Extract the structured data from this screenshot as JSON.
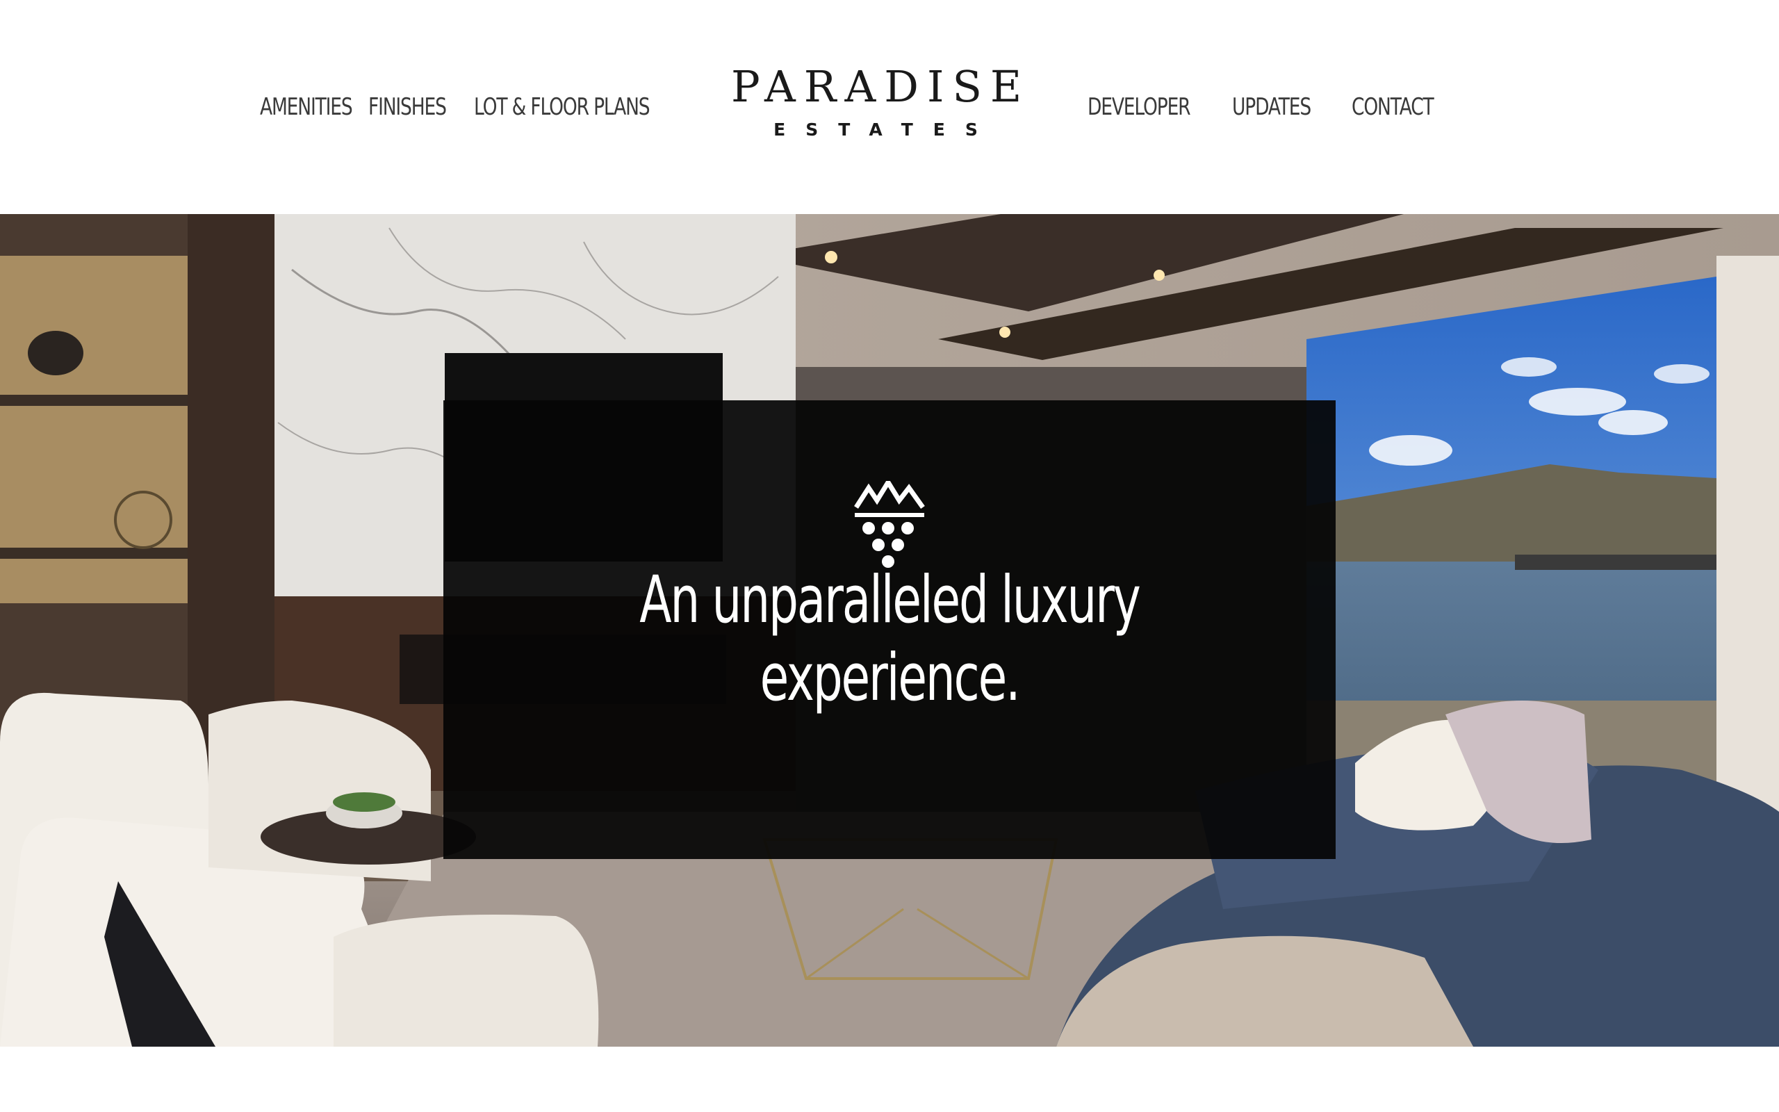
{
  "nav": {
    "left": [
      "AMENITIES",
      "FINISHES",
      "LOT & FLOOR PLANS"
    ],
    "right": [
      "DEVELOPER",
      "UPDATES",
      "CONTACT"
    ]
  },
  "logo": {
    "main": "PARADISE",
    "sub": "ESTATES"
  },
  "hero": {
    "tagline_line1": "An unparalleled luxury",
    "tagline_line2": "experience.",
    "emblem_icon": "mountain-grapes-icon"
  },
  "colors": {
    "nav_text": "#3a3a3a",
    "logo": "#1a1a1a",
    "overlay": "#050505",
    "tagline": "#ffffff"
  }
}
